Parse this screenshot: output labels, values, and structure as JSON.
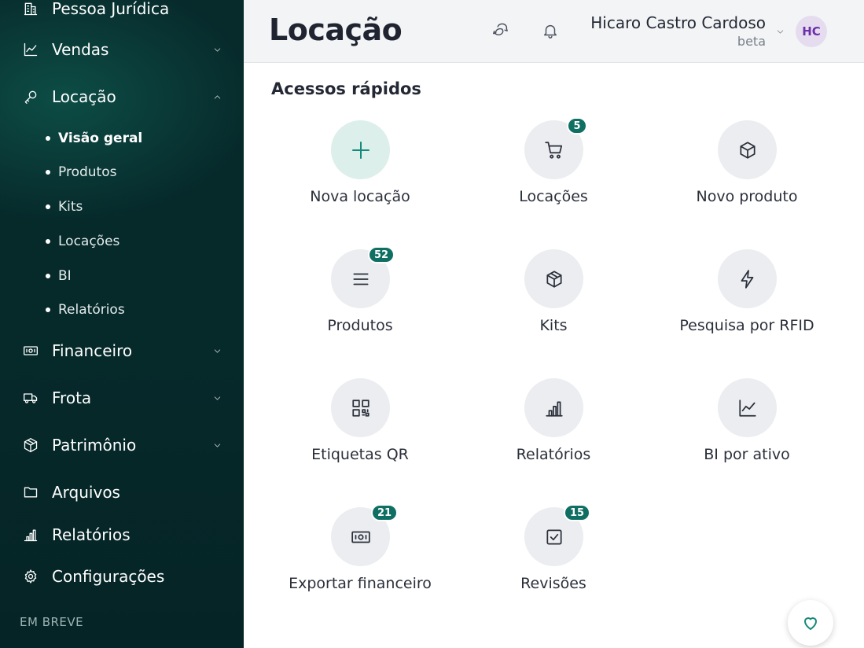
{
  "sidebar": {
    "nav": [
      {
        "label": "Pessoa Jurídica",
        "icon": "building-icon"
      },
      {
        "label": "Vendas",
        "icon": "line-chart-icon"
      },
      {
        "label": "Locação",
        "icon": "key-icon"
      },
      {
        "label": "Financeiro",
        "icon": "banknote-icon"
      },
      {
        "label": "Frota",
        "icon": "truck-icon"
      },
      {
        "label": "Patrimônio",
        "icon": "package-icon"
      },
      {
        "label": "Arquivos",
        "icon": "folder-icon"
      },
      {
        "label": "Relatórios",
        "icon": "bar-chart-icon"
      },
      {
        "label": "Configurações",
        "icon": "gear-icon"
      }
    ],
    "sub": [
      {
        "label": "Visão geral"
      },
      {
        "label": "Produtos"
      },
      {
        "label": "Kits"
      },
      {
        "label": "Locações"
      },
      {
        "label": "BI"
      },
      {
        "label": "Relatórios"
      }
    ],
    "soon_label": "EM BREVE"
  },
  "header": {
    "title": "Locação",
    "user_name": "Hicaro Castro Cardoso",
    "user_role": "beta",
    "avatar_initials": "HC"
  },
  "main": {
    "section_title": "Acessos rápidos",
    "tiles": [
      {
        "label": "Nova locação",
        "icon": "plus-icon",
        "badge": null
      },
      {
        "label": "Locações",
        "icon": "cart-icon",
        "badge": "5"
      },
      {
        "label": "Novo produto",
        "icon": "cube-icon",
        "badge": null
      },
      {
        "label": "Produtos",
        "icon": "list-icon",
        "badge": "52"
      },
      {
        "label": "Kits",
        "icon": "package-icon",
        "badge": null
      },
      {
        "label": "Pesquisa por RFID",
        "icon": "lightning-icon",
        "badge": null
      },
      {
        "label": "Etiquetas QR",
        "icon": "qr-code-icon",
        "badge": null
      },
      {
        "label": "Relatórios",
        "icon": "bar-chart-icon",
        "badge": null
      },
      {
        "label": "BI por ativo",
        "icon": "line-chart-icon",
        "badge": null
      },
      {
        "label": "Exportar financeiro",
        "icon": "banknote-icon",
        "badge": "21"
      },
      {
        "label": "Revisões",
        "icon": "checkbox-icon",
        "badge": "15"
      }
    ]
  },
  "colors": {
    "sidebar_bg": "#072a2b",
    "accent": "#158a7a",
    "badge": "#0f6f62",
    "avatar_bg": "#e6dcef",
    "avatar_text": "#6b2fa8"
  }
}
